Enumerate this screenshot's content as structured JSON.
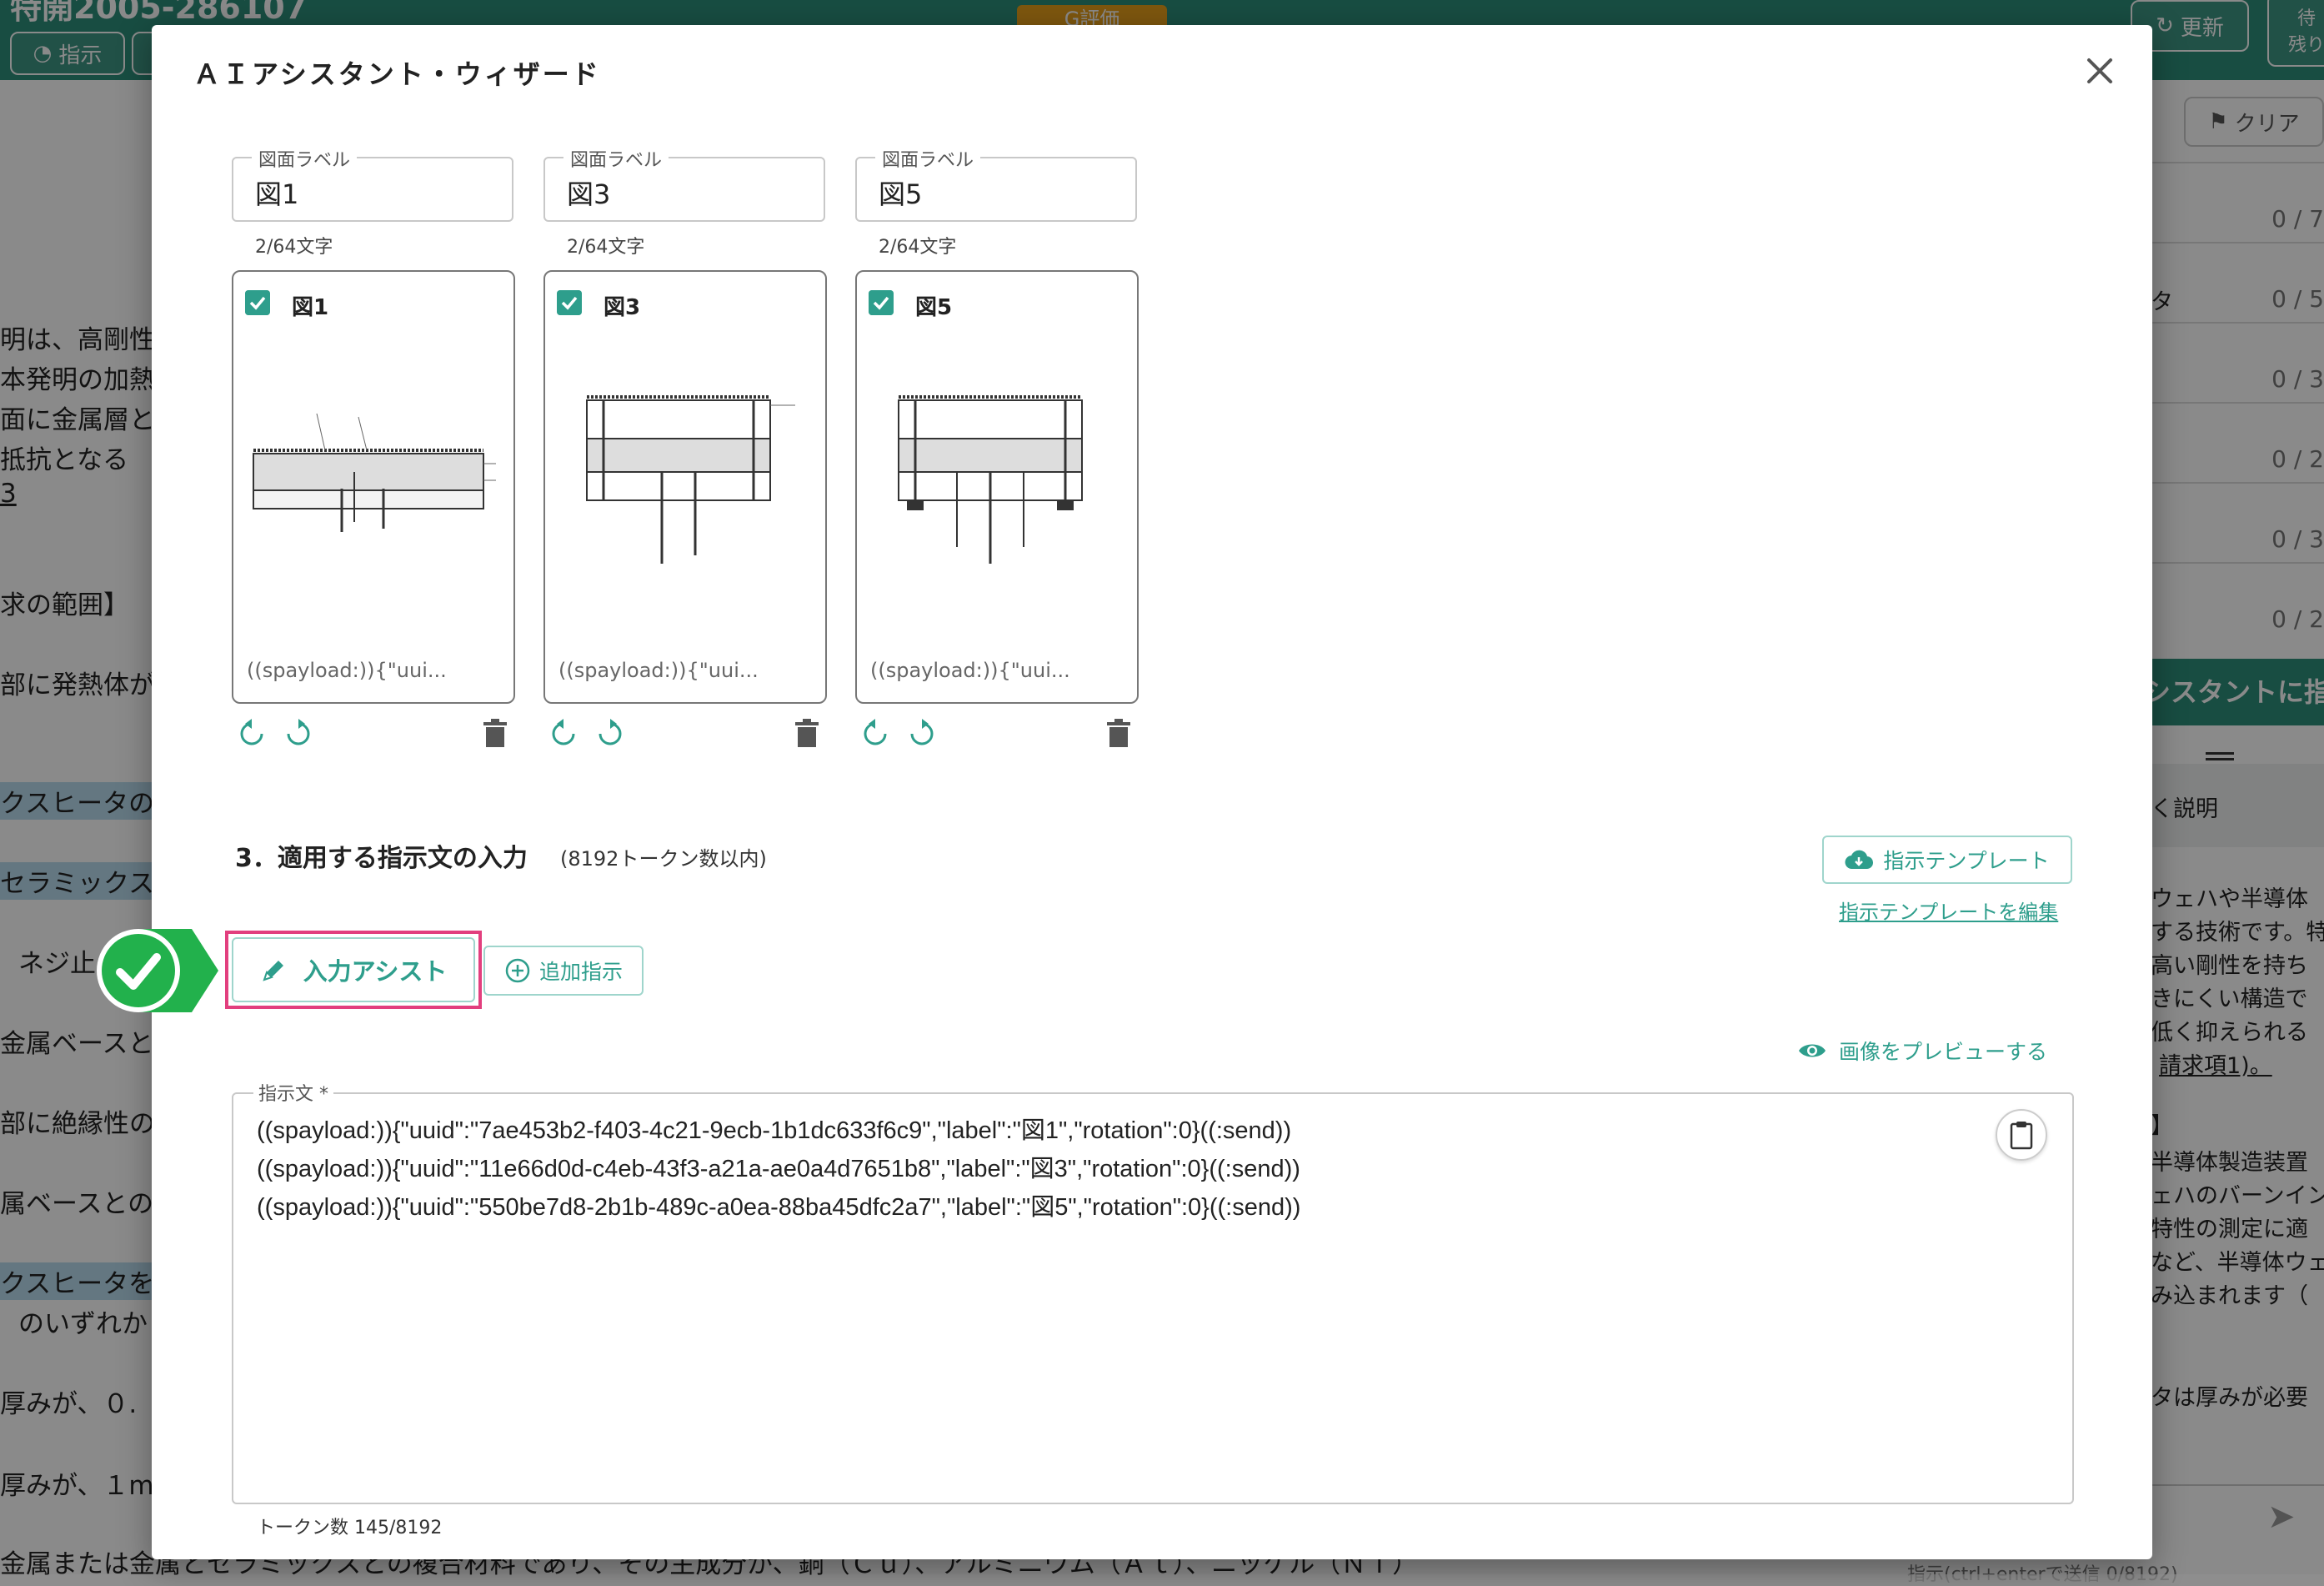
{
  "background": {
    "title": "特開2005-286107",
    "header_buttons": {
      "instruct": "指示",
      "update": "更新",
      "remain_a": "待",
      "remain_b": "残り"
    },
    "badge": "G評価",
    "clear": "クリア",
    "body_lines": [
      "明は、高剛性",
      "本発明の加熱",
      "面に金属層と",
      "抵抗となる",
      "3",
      "求の範囲】",
      "部に発熱体が",
      "クスヒータの",
      "セラミックス",
      "ネジ止",
      "金属ベースと",
      "部に絶縁性の",
      "属ベースとの",
      "クスヒータを",
      "のいずれか",
      "厚みが、０.",
      "厚みが、１m",
      "金属または金属とセラミックスとの複合材料であり、その主成分が、銅（Ｃｕ）、アルミニウム（Ａｌ）、ニッケル（Ｎｉ）"
    ],
    "counts": [
      "0 / 7",
      "0 / 5",
      "0 / 3",
      "0 / 2",
      "0 / 3",
      "0 / 2"
    ],
    "right_labels": [
      "タ"
    ],
    "assist_label": "シスタントに指",
    "explain_label": "く説明",
    "right_text": [
      "ウェハや半導体",
      "する技術です。特",
      "高い剛性を持ち",
      "きにくい構造で",
      "低く抑えられる",
      "請求項1)。",
      "】",
      "半導体製造装置",
      "ェハのバーンイン",
      "特性の測定に適",
      "など、半導体ウェ",
      "み込まれます（",
      "タは厚みが必要"
    ],
    "footer_hint": "指示(ctrl+enterで送信  0/8192)"
  },
  "modal": {
    "title": "ＡＩアシスタント・ウィザード",
    "figures": [
      {
        "field_label": "図面ラベル",
        "value": "図1",
        "counter": "2/64文字",
        "name": "図1",
        "caption": "((spayload:)){\"uui..."
      },
      {
        "field_label": "図面ラベル",
        "value": "図3",
        "counter": "2/64文字",
        "name": "図3",
        "caption": "((spayload:)){\"uui..."
      },
      {
        "field_label": "図面ラベル",
        "value": "図5",
        "counter": "2/64文字",
        "name": "図5",
        "caption": "((spayload:)){\"uui..."
      }
    ],
    "section_title": "3．適用する指示文の入力",
    "section_sub": "(8192トークン数以内)",
    "template_button": "指示テンプレート",
    "template_edit_link": "指示テンプレートを編集",
    "assist_button": "入力アシスト",
    "add_button": "追加指示",
    "preview_link": "画像をプレビューする",
    "textarea_label": "指示文 *",
    "instruction_lines": [
      "((spayload:)){\"uuid\":\"7ae453b2-f403-4c21-9ecb-1b1dc633f6c9\",\"label\":\"図1\",\"rotation\":0}((:send))",
      "((spayload:)){\"uuid\":\"11e66d0d-c4eb-43f3-a21a-ae0a4d7651b8\",\"label\":\"図3\",\"rotation\":0}((:send))",
      "((spayload:)){\"uuid\":\"550be7d8-2b1b-489c-a0ea-88ba45dfc2a7\",\"label\":\"図5\",\"rotation\":0}((:send))"
    ],
    "tokens": "トークン数 145/8192"
  },
  "colors": {
    "accent": "#2e9e8c",
    "highlight": "#e23f7e",
    "success": "#22b14c",
    "header": "#2e8e7a"
  }
}
